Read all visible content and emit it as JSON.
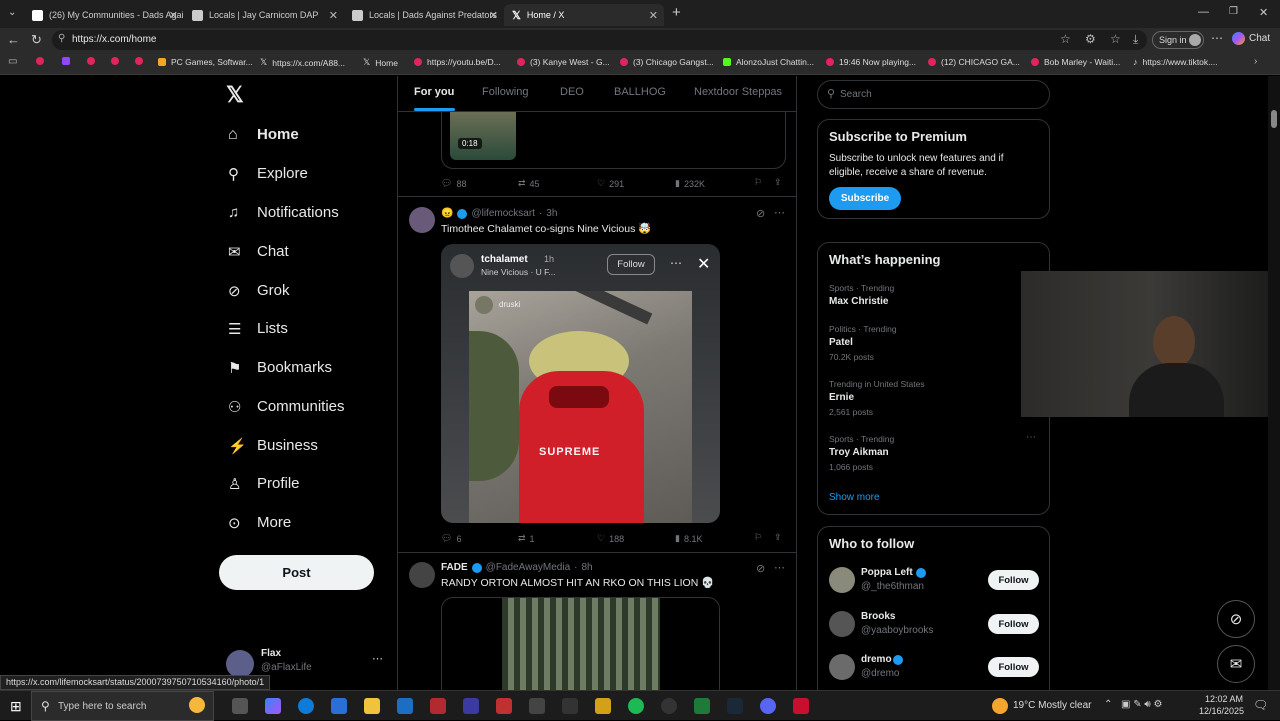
{
  "browser": {
    "tabs": [
      {
        "title": "(26) My Communities - Dads Agai"
      },
      {
        "title": "Locals | Jay Carnicom DAP"
      },
      {
        "title": "Locals | Dads Against Predators"
      },
      {
        "title": "Home / X"
      }
    ],
    "url": "https://x.com/home",
    "signin_label": "Sign in",
    "chat_label": "Chat",
    "bookmarks": [
      "PC Games, Softwar...",
      "https://x.com/A88...",
      "Home",
      "https://youtu.be/D...",
      "(3) Kanye West - G...",
      "(3) Chicago Gangst...",
      "AlonzoJust Chattin...",
      "19:46 Now playing...",
      "(12) CHICAGO GA...",
      "Bob Marley - Waiti...",
      "https://www.tiktok...."
    ],
    "status_url": "https://x.com/lifemocksart/status/2000739750710534160/photo/1"
  },
  "nav": {
    "items": [
      "Home",
      "Explore",
      "Notifications",
      "Chat",
      "Grok",
      "Lists",
      "Bookmarks",
      "Communities",
      "Business",
      "Profile",
      "More"
    ],
    "post_label": "Post",
    "account": {
      "name": "Flax",
      "handle": "@aFlaxLife"
    }
  },
  "feed": {
    "tabs": [
      "For you",
      "Following",
      "DEO",
      "BALLHOG",
      "Nextdoor Steppas"
    ],
    "video_duration": "0:18",
    "prev_stats": {
      "replies": "88",
      "reposts": "45",
      "likes": "291",
      "views": "232K"
    },
    "tweets": [
      {
        "handle": "@lifemocksart",
        "time": "3h",
        "text": "Timothee Chalamet co-signs Nine Vicious 🤯",
        "embed": {
          "user": "tchalamet",
          "time": "1h",
          "song": "Nine Vicious · U F...",
          "follow_label": "Follow",
          "inner_user": "druski",
          "shirt_text": "SUPREME"
        },
        "stats": {
          "replies": "6",
          "reposts": "1",
          "likes": "188",
          "views": "8.1K"
        }
      },
      {
        "name": "FADE",
        "handle": "@FadeAwayMedia",
        "time": "8h",
        "text": "RANDY ORTON ALMOST HIT AN RKO ON THIS LION 💀"
      }
    ]
  },
  "sidebar": {
    "search_placeholder": "Search",
    "premium": {
      "title": "Subscribe to Premium",
      "body": "Subscribe to unlock new features and if eligible, receive a share of revenue.",
      "button": "Subscribe"
    },
    "happening": {
      "title": "What’s happening",
      "trends": [
        {
          "category": "Sports · Trending",
          "name": "Max Christie",
          "posts": ""
        },
        {
          "category": "Politics · Trending",
          "name": "Patel",
          "posts": "70.2K posts"
        },
        {
          "category": "Trending in United States",
          "name": "Ernie",
          "posts": "2,561 posts"
        },
        {
          "category": "Sports · Trending",
          "name": "Troy Aikman",
          "posts": "1,066 posts"
        }
      ],
      "show_more": "Show more"
    },
    "who_to_follow": {
      "title": "Who to follow",
      "users": [
        {
          "name": "Poppa Left",
          "handle": "@_the6thman",
          "button": "Follow"
        },
        {
          "name": "Brooks",
          "handle": "@yaaboybrooks",
          "button": "Follow"
        },
        {
          "name": "dremo",
          "handle": "@dremo",
          "button": "Follow"
        }
      ]
    }
  },
  "taskbar": {
    "search_placeholder": "Type here to search",
    "weather": "19°C  Mostly clear",
    "time": "12:02 AM",
    "date": "12/16/2025"
  },
  "colors": {
    "accent": "#1d9bf0",
    "background": "#000000",
    "border": "#2f3336",
    "muted": "#71767b"
  }
}
